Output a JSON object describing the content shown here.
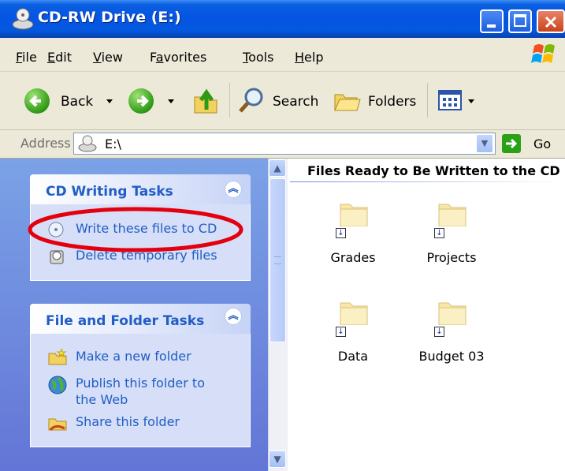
{
  "window": {
    "title": "CD-RW Drive (E:)"
  },
  "menu": {
    "items": [
      "File",
      "Edit",
      "View",
      "Favorites",
      "Tools",
      "Help"
    ],
    "underlines": [
      "F",
      "E",
      "V",
      "a",
      "T",
      "H"
    ]
  },
  "toolbar": {
    "back_label": "Back",
    "search_label": "Search",
    "folders_label": "Folders"
  },
  "address": {
    "label": "Address",
    "value": "E:\\",
    "go_label": "Go"
  },
  "cd_tasks": {
    "title": "CD Writing Tasks",
    "items": [
      {
        "label": "Write these files to CD",
        "icon": "cd-write-icon"
      },
      {
        "label": "Delete temporary files",
        "icon": "delete-temp-icon"
      }
    ]
  },
  "file_tasks": {
    "title": "File and Folder Tasks",
    "items": [
      {
        "label": "Make a new folder",
        "icon": "new-folder-icon"
      },
      {
        "label": "Publish this folder to the Web",
        "icon": "publish-web-icon"
      },
      {
        "label": "Share this folder",
        "icon": "share-folder-icon"
      }
    ]
  },
  "content": {
    "group_title": "Files Ready to Be Written to the CD",
    "folders": [
      {
        "name": "Grades"
      },
      {
        "name": "Projects"
      },
      {
        "name": "Data"
      },
      {
        "name": "Budget 03"
      }
    ]
  },
  "colors": {
    "title_bar": "#0554e3",
    "task_link": "#215dc6",
    "highlight_ellipse": "#e3000f"
  }
}
